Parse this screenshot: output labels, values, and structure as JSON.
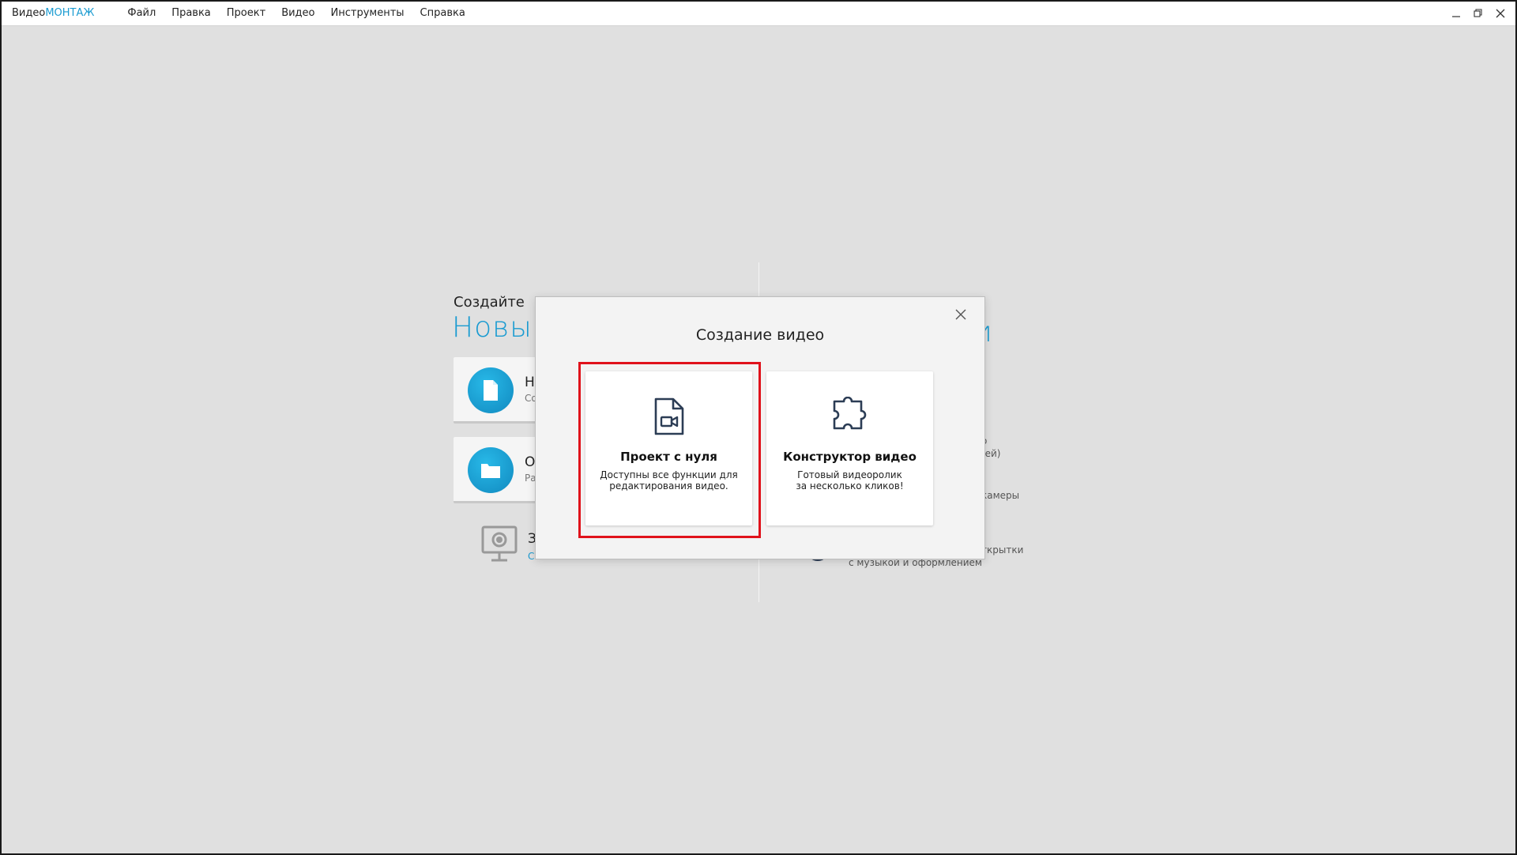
{
  "app": {
    "brand_part1": "Видео",
    "brand_part2": "МОНТАЖ",
    "accent_color": "#1a9bd1"
  },
  "menu": {
    "items": [
      "Файл",
      "Правка",
      "Проект",
      "Видео",
      "Инструменты",
      "Справка"
    ]
  },
  "window_controls": {
    "minimize_icon": "minimize-icon",
    "restore_icon": "restore-icon",
    "close_icon": "close-icon"
  },
  "background": {
    "create_label": "Создайте",
    "new_label": "Новый",
    "cards": [
      {
        "title": "Н",
        "subtitle": "Со",
        "icon": "file-icon"
      },
      {
        "title": "О",
        "subtitle": "Ра",
        "icon": "folder-icon"
      }
    ],
    "record": {
      "title": "З",
      "subtitle": "С",
      "icon": "webcam-icon"
    },
    "right_title": "и",
    "right_texts": [
      "о",
      "акей)",
      "камеры",
      "ткрытки",
      "с музыкой и оформлением"
    ]
  },
  "modal": {
    "title": "Создание видео",
    "close_icon": "close-icon",
    "options": [
      {
        "title": "Проект с нуля",
        "desc_line1": "Доступны все функции для",
        "desc_line2": "редактирования видео.",
        "icon": "video-file-icon"
      },
      {
        "title": "Конструктор видео",
        "desc_line1": "Готовый видеоролик",
        "desc_line2": "за несколько кликов!",
        "icon": "puzzle-icon"
      }
    ],
    "highlight_color": "#e0121b"
  }
}
